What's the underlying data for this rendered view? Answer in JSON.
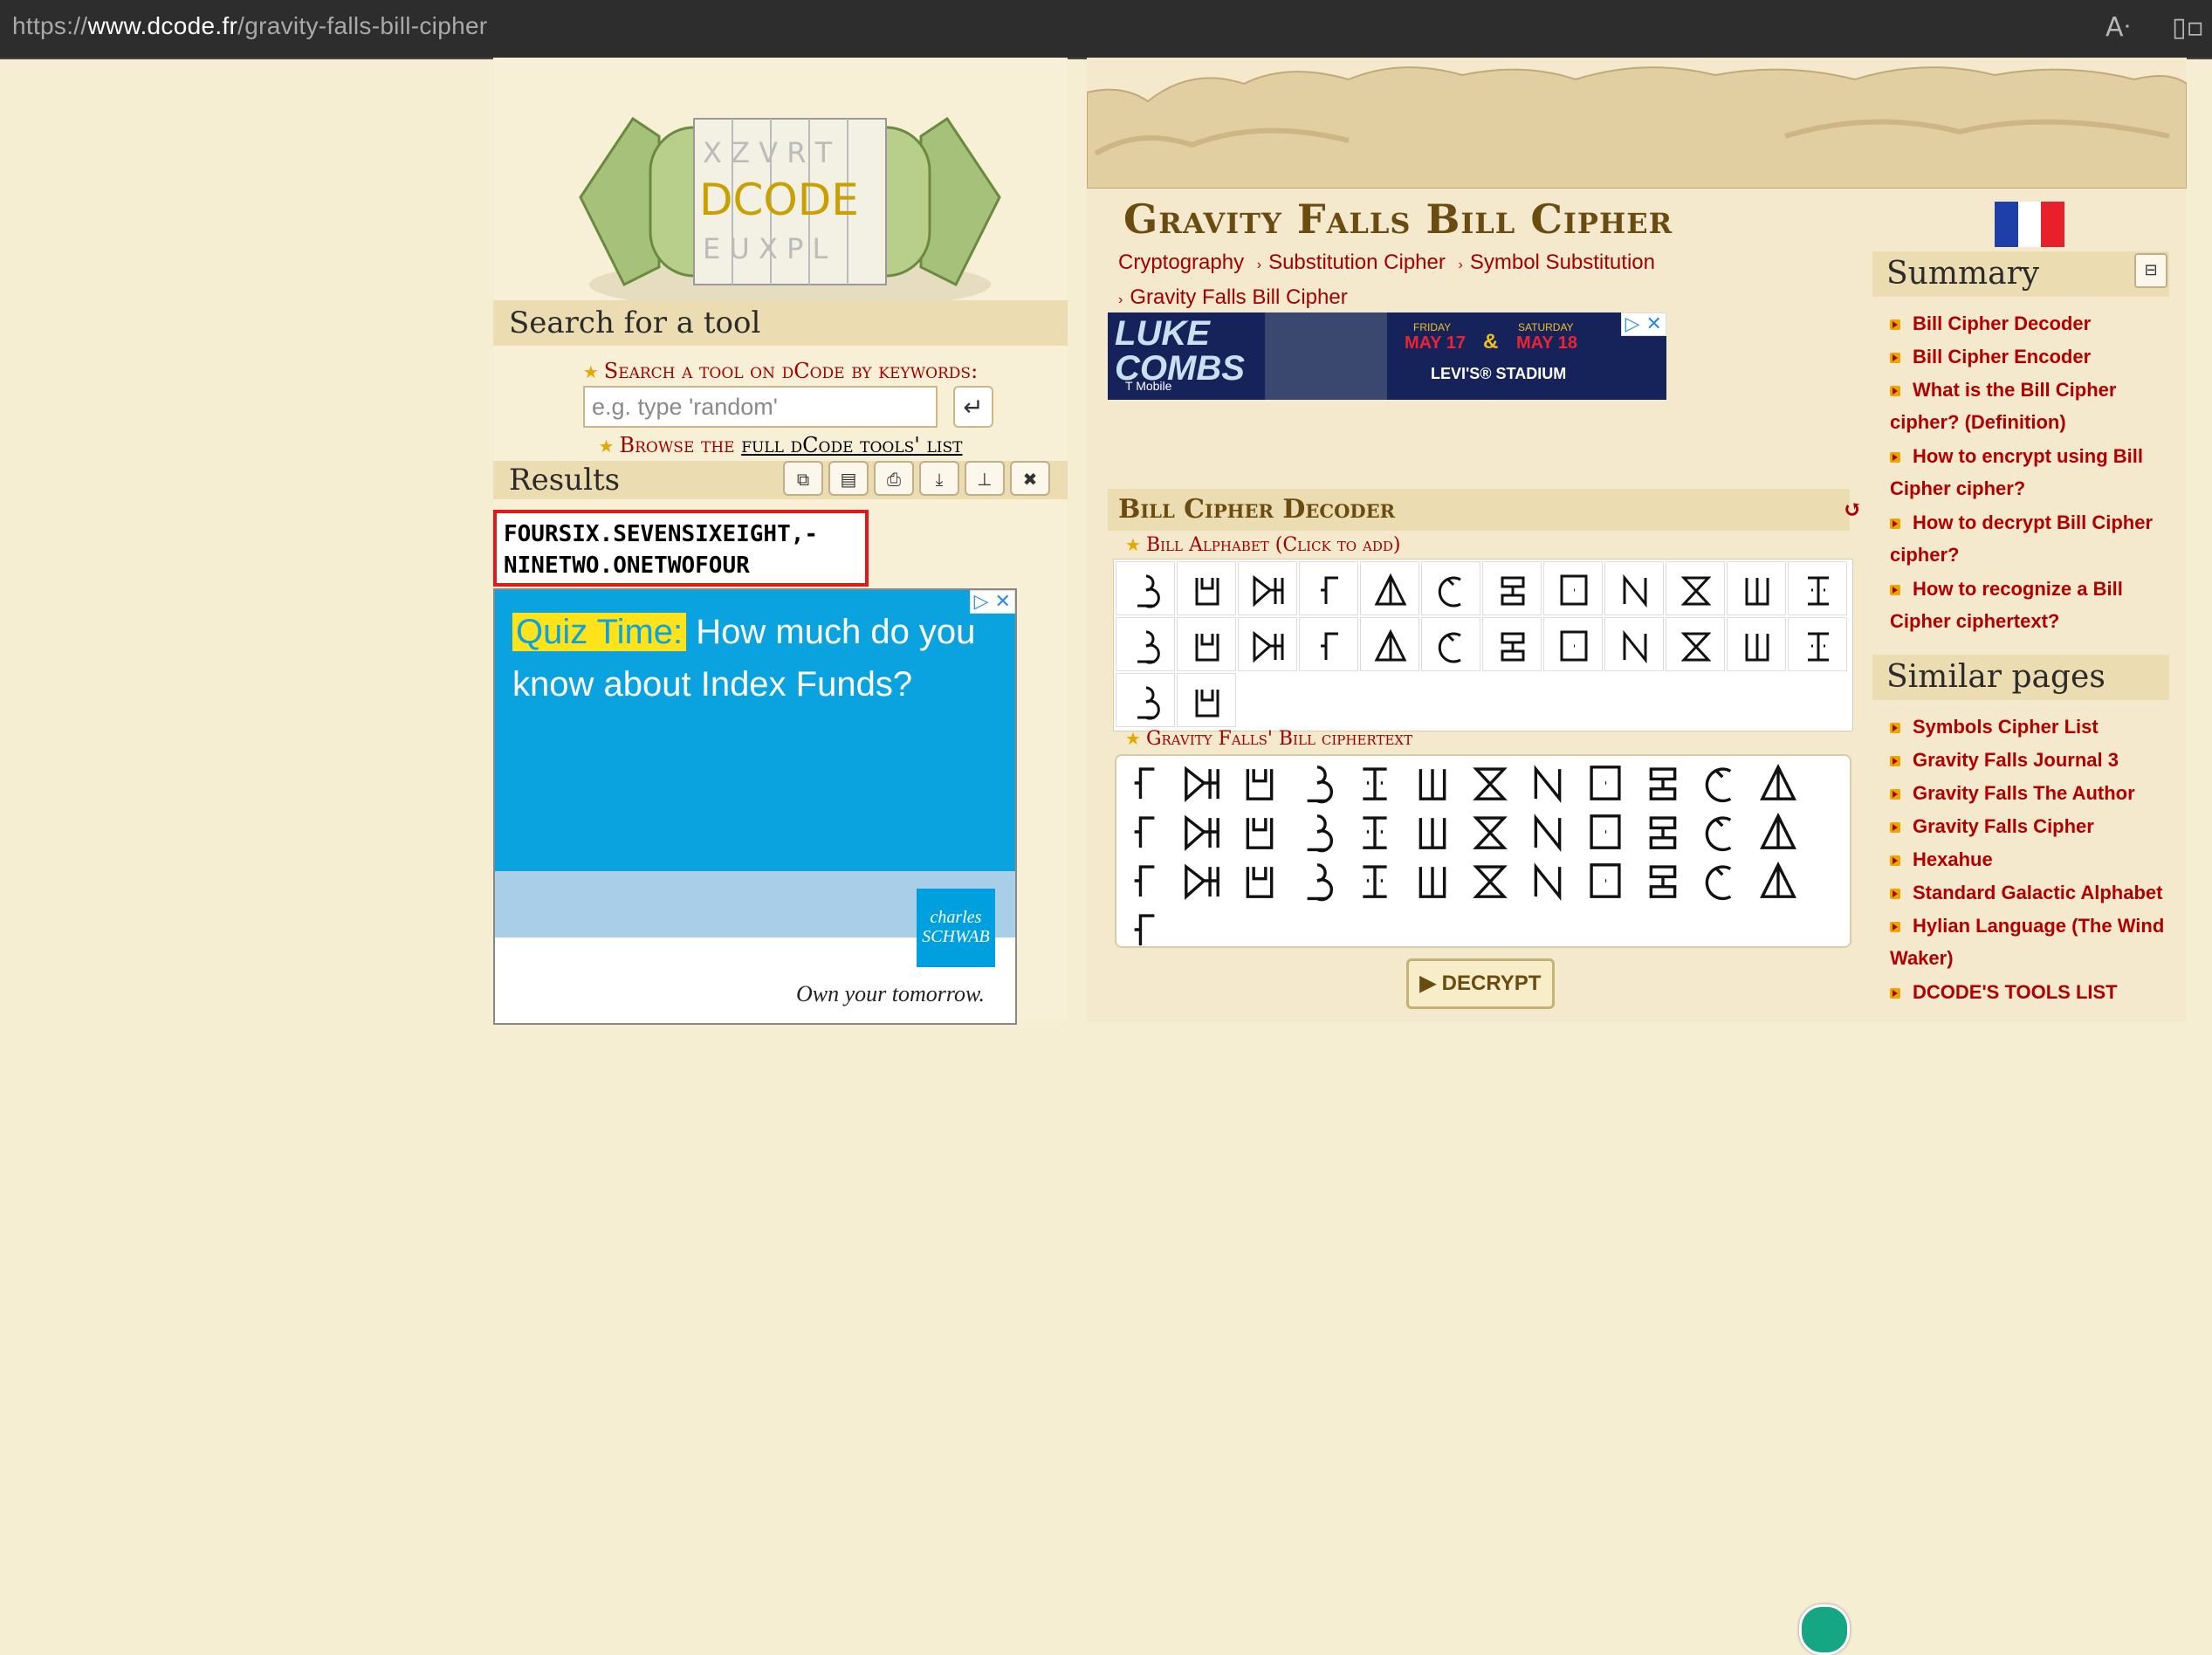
{
  "browser": {
    "url_prefix": "https://",
    "url_domain": "www.dcode.fr",
    "url_path": "/gravity-falls-bill-cipher"
  },
  "logo": {
    "text": "DCODE"
  },
  "search": {
    "heading": "Search for a tool",
    "label": "Search a tool on dCode by keywords:",
    "placeholder": "e.g. type 'random'",
    "browse_prefix": "Browse the ",
    "browse_link": "full dCode tools' list"
  },
  "results": {
    "heading": "Results",
    "text_line1": "FOURSIX.SEVENSIXEIGHT,-",
    "text_line2": "NINETWO.ONETWOFOUR"
  },
  "ad_left": {
    "highlight": "Quiz Time:",
    "text": " How much do you know about Index Funds?",
    "brand": "charles SCHWAB",
    "tagline": "Own your tomorrow."
  },
  "ad_top": {
    "artist": "LUKE COMBS",
    "sponsor": "T Mobile",
    "day1": "FRIDAY",
    "date1": "MAY 17",
    "day2": "SATURDAY",
    "date2": "MAY 18",
    "venue": "LEVI'S® STADIUM"
  },
  "page": {
    "title": "Gravity Falls Bill Cipher",
    "breadcrumbs": [
      "Cryptography",
      "Substitution Cipher",
      "Symbol Substitution",
      "Gravity Falls Bill Cipher"
    ]
  },
  "decoder": {
    "heading": "Bill Cipher Decoder",
    "alphabet_label": "Bill Alphabet (Click to add)",
    "ciphertext_label": "Gravity Falls' Bill ciphertext",
    "decrypt_label": "DECRYPT"
  },
  "summary": {
    "heading": "Summary",
    "items": [
      "Bill Cipher Decoder",
      "Bill Cipher Encoder",
      "What is the Bill Cipher cipher? (Definition)",
      "How to encrypt using Bill Cipher cipher?",
      "How to decrypt Bill Cipher cipher?",
      "How to recognize a Bill Cipher ciphertext?"
    ]
  },
  "similar": {
    "heading": "Similar pages",
    "items": [
      "Symbols Cipher List",
      "Gravity Falls Journal 3",
      "Gravity Falls The Author",
      "Gravity Falls Cipher",
      "Hexahue",
      "Standard Galactic Alphabet",
      "Hylian Language (The Wind Waker)",
      "DCODE'S TOOLS LIST"
    ]
  },
  "colors": {
    "accent_red": "#a30000",
    "title_brown": "#6b4c10",
    "header_tan": "#ecdcb1"
  }
}
